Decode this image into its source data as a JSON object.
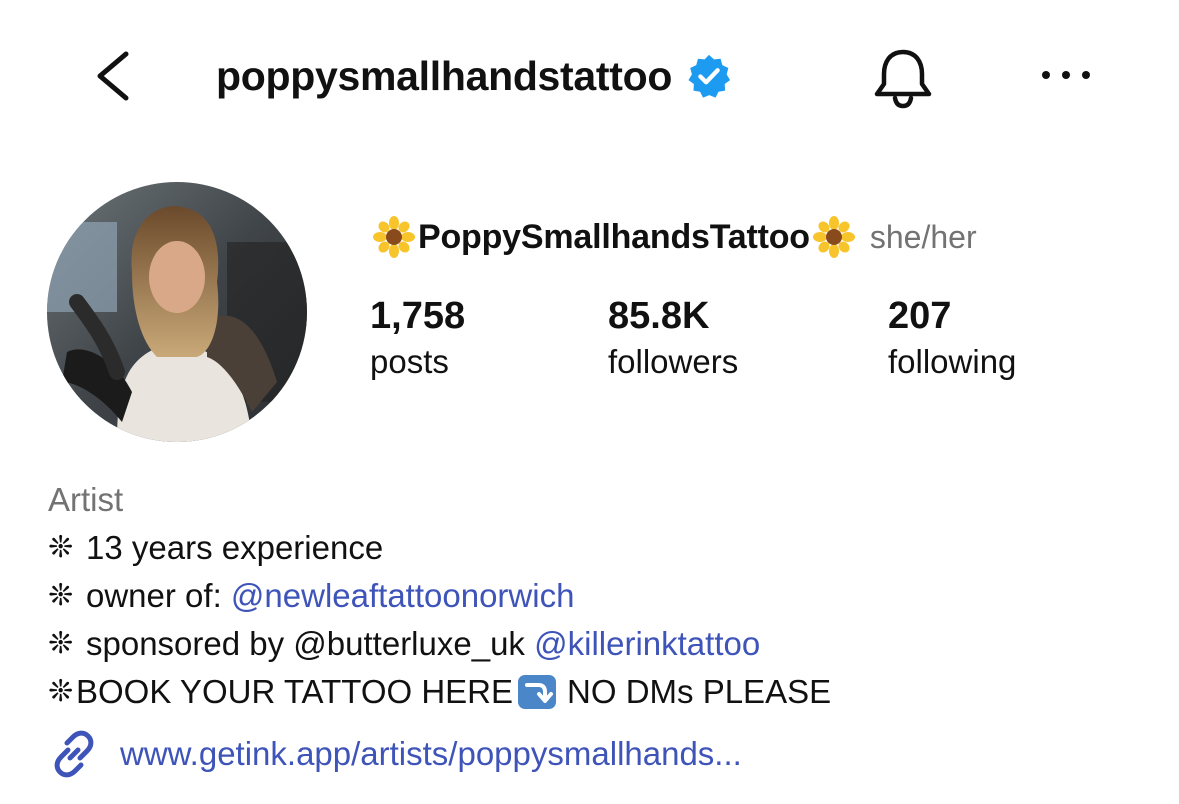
{
  "header": {
    "username": "poppysmallhandstattoo",
    "back_icon": "chevron-left-icon",
    "verified_icon": "verified-badge-icon",
    "bell_icon": "bell-icon",
    "more_icon": "more-horizontal-icon"
  },
  "profile": {
    "display_name": "PoppySmallhandsTattoo",
    "name_emoji": "sunflower",
    "pronouns": "she/her",
    "avatar_icon": "profile-photo"
  },
  "stats": {
    "posts": {
      "value": "1,758",
      "label": "posts"
    },
    "followers": {
      "value": "85.8K",
      "label": "followers"
    },
    "following": {
      "value": "207",
      "label": "following"
    }
  },
  "bio": {
    "category": "Artist",
    "bullet": "❊",
    "line1": "13 years experience",
    "line2_prefix": "owner of: ",
    "line2_link": "@newleaftattoonorwich",
    "line3_prefix": "sponsored by @butterluxe_uk ",
    "line3_link": "@killerinktattoo",
    "line4_prefix": "BOOK YOUR TATTOO HERE",
    "line4_emoji": "arrow-right-hook-down-icon",
    "line4_suffix": "NO DMs PLEASE",
    "website": "www.getink.app/artists/poppysmallhands...",
    "link_icon": "chain-link-icon"
  },
  "colors": {
    "link": "#3e54b8",
    "verified": "#1d9bf0",
    "secondary_text": "#737373"
  }
}
